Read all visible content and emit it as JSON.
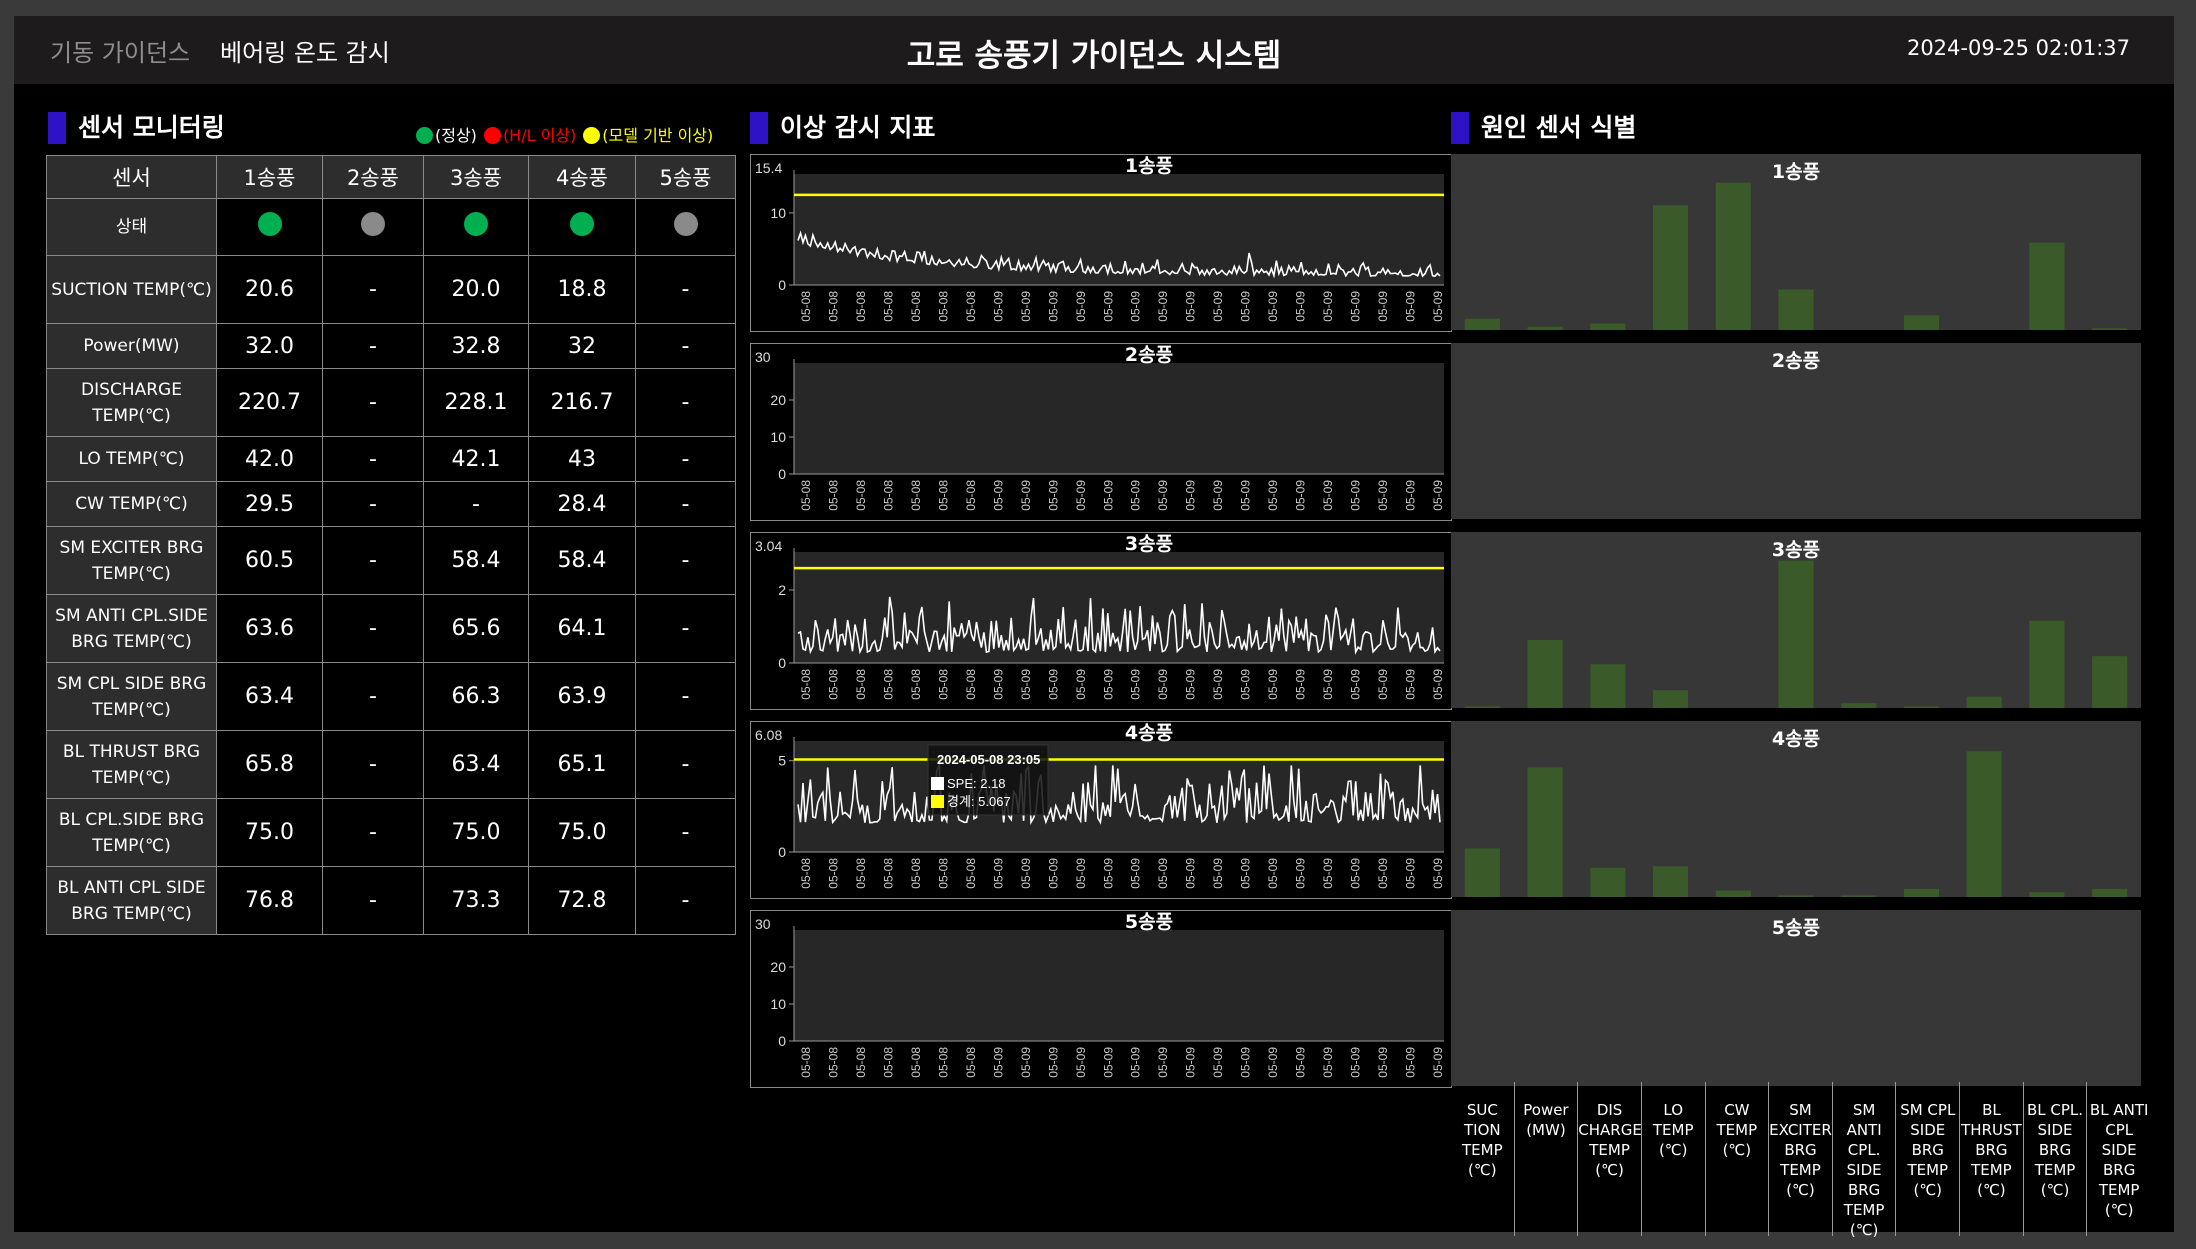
{
  "header": {
    "nav_items": [
      "기동 가이던스",
      "베어링 온도 감시"
    ],
    "title": "고로 송풍기 가이던스 시스템",
    "datetime": "2024-09-25 02:01:37"
  },
  "colors": {
    "normal": "#00b050",
    "hl_abnormal": "#ff0000",
    "model_abnormal": "#ffff00",
    "inactive": "#8a8a8a",
    "threshold_line": "#ffff00",
    "spe_line": "#ffffff",
    "bar": "#3a5a2a",
    "panel_marker": "#2d13c5"
  },
  "sensor_panel": {
    "title": "센서 모니터링",
    "legend": [
      {
        "label": "(정상)",
        "color": "#00b050",
        "text_color": "#ffffff"
      },
      {
        "label": "(H/L 이상)",
        "color": "#ff0000",
        "text_color": "#ff0000"
      },
      {
        "label": "(모델 기반 이상)",
        "color": "#ffff00",
        "text_color": "#ffff00"
      }
    ],
    "columns": [
      "센서",
      "1송풍",
      "2송풍",
      "3송풍",
      "4송풍",
      "5송풍"
    ],
    "status_label": "상태",
    "status": [
      "normal",
      "inactive",
      "normal",
      "normal",
      "inactive"
    ],
    "rows": [
      {
        "label": "SUCTION TEMP(℃)",
        "values": [
          "20.6",
          "-",
          "20.0",
          "18.8",
          "-"
        ]
      },
      {
        "label": "Power(MW)",
        "values": [
          "32.0",
          "-",
          "32.8",
          "32",
          "-"
        ]
      },
      {
        "label": "DISCHARGE TEMP(℃)",
        "values": [
          "220.7",
          "-",
          "228.1",
          "216.7",
          "-"
        ]
      },
      {
        "label": "LO TEMP(℃)",
        "values": [
          "42.0",
          "-",
          "42.1",
          "43",
          "-"
        ]
      },
      {
        "label": "CW TEMP(℃)",
        "values": [
          "29.5",
          "-",
          "-",
          "28.4",
          "-"
        ]
      },
      {
        "label": "SM EXCITER BRG TEMP(℃)",
        "values": [
          "60.5",
          "-",
          "58.4",
          "58.4",
          "-"
        ]
      },
      {
        "label": "SM ANTI CPL.SIDE BRG TEMP(℃)",
        "values": [
          "63.6",
          "-",
          "65.6",
          "64.1",
          "-"
        ]
      },
      {
        "label": "SM CPL SIDE BRG TEMP(℃)",
        "values": [
          "63.4",
          "-",
          "66.3",
          "63.9",
          "-"
        ]
      },
      {
        "label": "BL THRUST BRG TEMP(℃)",
        "values": [
          "65.8",
          "-",
          "63.4",
          "65.1",
          "-"
        ]
      },
      {
        "label": "BL CPL.SIDE BRG TEMP(℃)",
        "values": [
          "75.0",
          "-",
          "75.0",
          "75.0",
          "-"
        ]
      },
      {
        "label": "BL ANTI CPL SIDE BRG TEMP(℃)",
        "values": [
          "76.8",
          "-",
          "73.3",
          "72.8",
          "-"
        ]
      }
    ]
  },
  "anomaly_panel": {
    "title": "이상 감시 지표",
    "x_tick_labels": [
      "05-08",
      "05-08",
      "05-08",
      "05-08",
      "05-08",
      "05-08",
      "05-08",
      "05-09",
      "05-09",
      "05-09",
      "05-09",
      "05-09",
      "05-09",
      "05-09",
      "05-09",
      "05-09",
      "05-09",
      "05-09",
      "05-09",
      "05-09",
      "05-09",
      "05-09",
      "05-09",
      "05-09"
    ],
    "charts": [
      {
        "name": "1송풍",
        "ymax": 15.4,
        "ymax_label": "15.4",
        "ticks": [
          0,
          10
        ],
        "threshold": 12.5,
        "has_data": true,
        "profile": "decay",
        "base": 1.2,
        "amp": 4.5,
        "noise": 1.3
      },
      {
        "name": "2송풍",
        "ymax": 30,
        "ymax_label": "30",
        "ticks": [
          0,
          10,
          20
        ],
        "threshold": null,
        "has_data": false
      },
      {
        "name": "3송풍",
        "ymax": 3.04,
        "ymax_label": "3.04",
        "ticks": [
          0,
          2
        ],
        "threshold": 2.6,
        "has_data": true,
        "profile": "flat",
        "base": 0.3,
        "amp": 0,
        "noise": 0.9
      },
      {
        "name": "4송풍",
        "ymax": 6.08,
        "ymax_label": "6.08",
        "ticks": [
          0,
          5
        ],
        "threshold": 5.067,
        "has_data": true,
        "profile": "flat",
        "base": 1.6,
        "amp": 0,
        "noise": 2.1
      },
      {
        "name": "5송풍",
        "ymax": 30,
        "ymax_label": "30",
        "ticks": [
          0,
          10,
          20
        ],
        "threshold": null,
        "has_data": false
      }
    ],
    "tooltip": {
      "title": "2024-05-08 23:05",
      "spe_label": "SPE: 2.18",
      "threshold_label": "경계: 5.067"
    }
  },
  "cause_panel": {
    "title": "원인 센서 식별",
    "categories": [
      "SUC TION TEMP (℃)",
      "Power (MW)",
      "DIS CHARGE TEMP (℃)",
      "LO TEMP (℃)",
      "CW TEMP (℃)",
      "SM EXCITER BRG TEMP (℃)",
      "SM ANTI CPL. SIDE BRG TEMP (℃)",
      "SM CPL SIDE BRG TEMP (℃)",
      "BL THRUST BRG TEMP (℃)",
      "BL CPL. SIDE BRG TEMP (℃)",
      "BL ANTI CPL SIDE BRG TEMP (℃)"
    ],
    "category_lines": [
      [
        "SUC",
        "TION",
        "TEMP",
        "(℃)"
      ],
      [
        "Power",
        "(MW)"
      ],
      [
        "DIS",
        "CHARGE",
        "TEMP",
        "(℃)"
      ],
      [
        "LO",
        "TEMP",
        "(℃)"
      ],
      [
        "CW",
        "TEMP",
        "(℃)"
      ],
      [
        "SM",
        "EXCITER",
        "BRG",
        "TEMP",
        "(℃)"
      ],
      [
        "SM",
        "ANTI",
        "CPL.",
        "SIDE",
        "BRG",
        "TEMP",
        "(℃)"
      ],
      [
        "SM CPL",
        "SIDE",
        "BRG",
        "TEMP",
        "(℃)"
      ],
      [
        "BL",
        "THRUST",
        "BRG",
        "TEMP",
        "(℃)"
      ],
      [
        "BL CPL.",
        "SIDE",
        "BRG",
        "TEMP",
        "(℃)"
      ],
      [
        "BL ANTI",
        "CPL",
        "SIDE",
        "BRG",
        "TEMP",
        "(℃)"
      ]
    ],
    "charts": [
      {
        "name": "1송풍",
        "values": [
          0.07,
          0.02,
          0.04,
          0.77,
          0.91,
          0.25,
          0.0,
          0.09,
          0.0,
          0.54,
          0.01
        ]
      },
      {
        "name": "2송풍",
        "values": [
          0,
          0,
          0,
          0,
          0,
          0,
          0,
          0,
          0,
          0,
          0
        ]
      },
      {
        "name": "3송풍",
        "values": [
          0.01,
          0.42,
          0.27,
          0.11,
          0.0,
          0.91,
          0.03,
          0.01,
          0.07,
          0.54,
          0.32
        ]
      },
      {
        "name": "4송풍",
        "values": [
          0.3,
          0.8,
          0.18,
          0.19,
          0.04,
          0.01,
          0.01,
          0.05,
          0.9,
          0.03,
          0.05
        ]
      },
      {
        "name": "5송풍",
        "values": [
          0,
          0,
          0,
          0,
          0,
          0,
          0,
          0,
          0,
          0,
          0
        ]
      }
    ]
  }
}
